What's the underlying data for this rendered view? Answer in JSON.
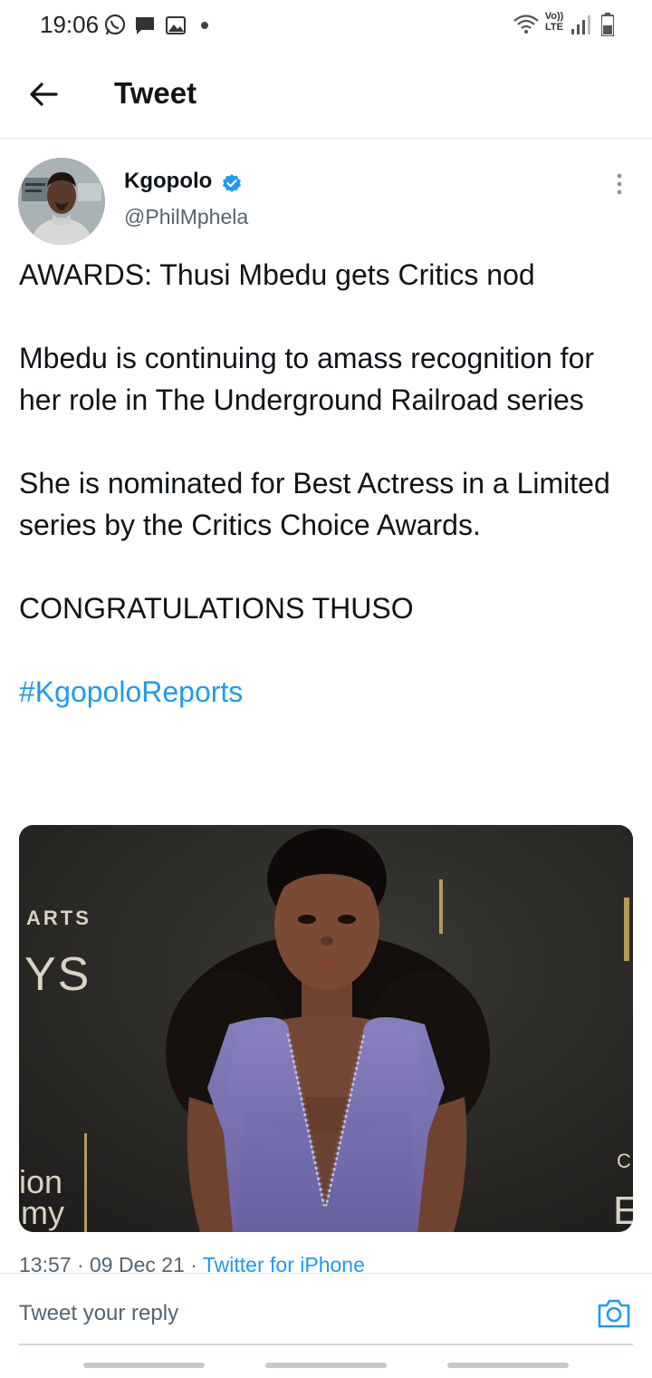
{
  "status_bar": {
    "time": "19:06",
    "icons": [
      "whatsapp-icon",
      "chat-icon",
      "gallery-icon",
      "dot-icon",
      "wifi-icon",
      "volte-icon",
      "signal-icon",
      "battery-icon"
    ],
    "volte_line1": "Vo))",
    "volte_line2": "LTE"
  },
  "header": {
    "title": "Tweet"
  },
  "tweet": {
    "author_name": "Kgopolo",
    "author_handle": "@PhilMphela",
    "line1": "AWARDS: Thusi Mbedu gets Critics nod",
    "para2": "Mbedu is continuing to amass recognition for her role in The Underground Railroad series",
    "para3": "She is nominated for Best Actress in a Limited series by the Critics Choice Awards.",
    "line4": "CONGRATULATIONS THUSO",
    "hashtag": "#KgopoloReports",
    "media_backdrop_text": {
      "left_top": "ARTS",
      "left_mid": "YS",
      "left_bottom1": "ion",
      "left_bottom2": "my",
      "right_c": "C",
      "right_e": "E"
    },
    "time": "13:57",
    "date": "09 Dec 21",
    "separator": " · ",
    "source": "Twitter for iPhone"
  },
  "reply": {
    "placeholder": "Tweet your reply"
  },
  "colors": {
    "accent": "#1d9bf0",
    "text": "#0f1419",
    "secondary": "#536471",
    "dress": "#7b75b8"
  }
}
